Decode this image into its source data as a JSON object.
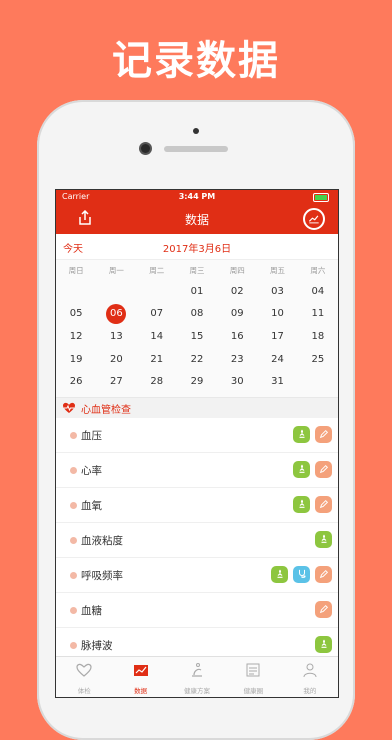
{
  "promo": {
    "title": "记录数据"
  },
  "status": {
    "carrier": "Carrier",
    "time": "3:44 PM"
  },
  "navbar": {
    "title": "数据"
  },
  "datebar": {
    "today": "今天",
    "date": "2017年3月6日"
  },
  "calendar": {
    "weekdays": [
      "周日",
      "周一",
      "周二",
      "周三",
      "周四",
      "周五",
      "周六"
    ],
    "weeks": [
      [
        "",
        "",
        "",
        "01",
        "02",
        "03",
        "04"
      ],
      [
        "05",
        "06",
        "07",
        "08",
        "09",
        "10",
        "11"
      ],
      [
        "12",
        "13",
        "14",
        "15",
        "16",
        "17",
        "18"
      ],
      [
        "19",
        "20",
        "21",
        "22",
        "23",
        "24",
        "25"
      ],
      [
        "26",
        "27",
        "28",
        "29",
        "30",
        "31",
        ""
      ]
    ],
    "selected": "06"
  },
  "section": {
    "title": "心血管检查"
  },
  "items": [
    {
      "label": "血压",
      "buttons": [
        "green",
        "orange"
      ]
    },
    {
      "label": "心率",
      "buttons": [
        "green",
        "orange"
      ]
    },
    {
      "label": "血氧",
      "buttons": [
        "green",
        "orange"
      ]
    },
    {
      "label": "血液粘度",
      "buttons": [
        "green"
      ]
    },
    {
      "label": "呼吸频率",
      "buttons": [
        "green",
        "blue",
        "orange"
      ]
    },
    {
      "label": "血糖",
      "buttons": [
        "orange"
      ]
    },
    {
      "label": "脉搏波",
      "buttons": [
        "green"
      ]
    }
  ],
  "tabs": [
    {
      "label": "体检",
      "icon": "heart-outline-icon",
      "active": false
    },
    {
      "label": "数据",
      "icon": "chart-book-icon",
      "active": true
    },
    {
      "label": "健康方案",
      "icon": "yoga-icon",
      "active": false
    },
    {
      "label": "健康圈",
      "icon": "notes-icon",
      "active": false
    },
    {
      "label": "我的",
      "icon": "person-icon",
      "active": false
    }
  ],
  "colors": {
    "accent": "#E02E15",
    "background": "#FE7A5C",
    "green": "#8DC63F",
    "orange": "#F4A17B",
    "blue": "#5BC2E7"
  }
}
